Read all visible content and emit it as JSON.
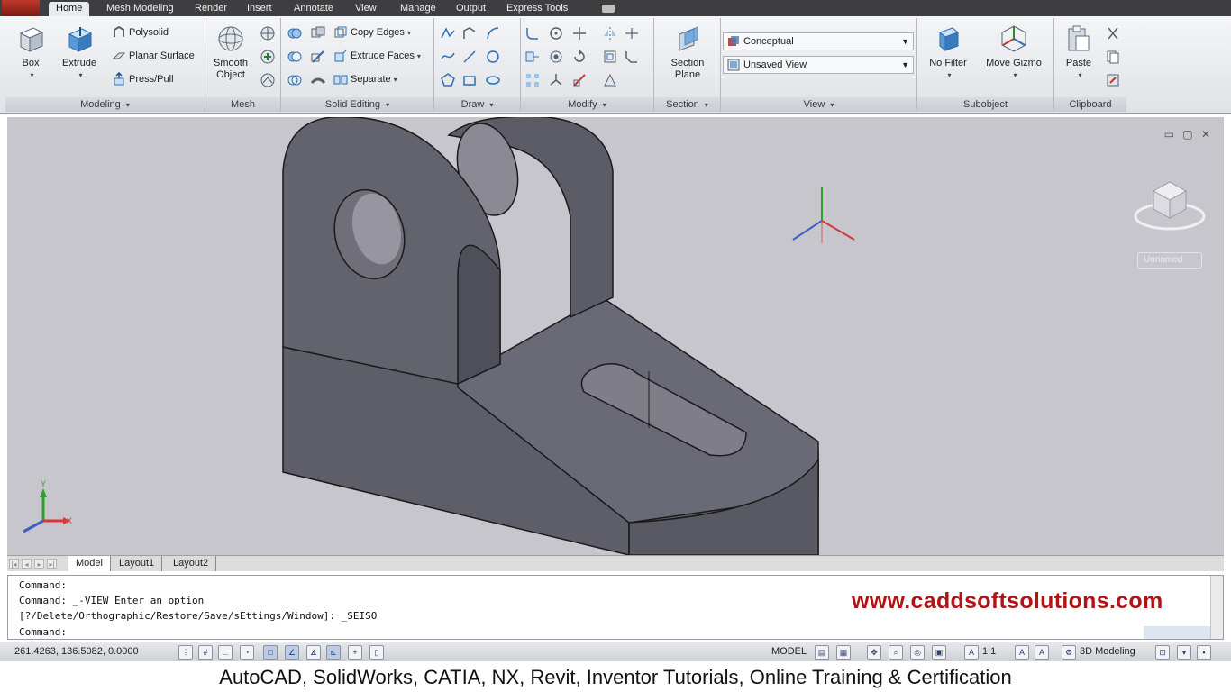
{
  "ribbon_tabs": [
    "Home",
    "Mesh Modeling",
    "Render",
    "Insert",
    "Annotate",
    "View",
    "Manage",
    "Output",
    "Express Tools"
  ],
  "active_tab": "Home",
  "panels": {
    "modeling": {
      "title": "Modeling",
      "box": "Box",
      "extrude": "Extrude",
      "polysolid": "Polysolid",
      "planar_surface": "Planar Surface",
      "press_pull": "Press/Pull"
    },
    "mesh": {
      "title": "Mesh",
      "smooth_object": "Smooth Object"
    },
    "solid_editing": {
      "title": "Solid Editing",
      "copy_edges": "Copy Edges",
      "extrude_faces": "Extrude Faces",
      "separate": "Separate"
    },
    "draw": {
      "title": "Draw"
    },
    "modify": {
      "title": "Modify"
    },
    "section": {
      "title": "Section",
      "section_plane": "Section Plane"
    },
    "view": {
      "title": "View",
      "visual_style": "Conceptual",
      "named_view": "Unsaved View"
    },
    "subobject": {
      "title": "Subobject",
      "no_filter": "No Filter",
      "move_gizmo": "Move Gizmo"
    },
    "clipboard": {
      "title": "Clipboard",
      "paste": "Paste"
    }
  },
  "viewport": {
    "controls": "▭ ▢ ✕",
    "viewcube_label": "Unnamed",
    "ucs_x": "X",
    "ucs_y": "Y",
    "model_fill": "#5f5f6a",
    "background": "#c7c6cc"
  },
  "layout_tabs": [
    "Model",
    "Layout1",
    "Layout2"
  ],
  "command": {
    "line1": "Command:",
    "line2": "Command: _-VIEW Enter an option",
    "line3": "[?/Delete/Orthographic/Restore/Save/sEttings/Window]: _SEISO",
    "prompt": "Command:",
    "watermark": "www.caddsoftsolutions.com"
  },
  "status": {
    "coords": "261.4263, 136.5082, 0.0000",
    "model": "MODEL",
    "scale": "1:1",
    "workspace": "3D Modeling"
  },
  "caption": "AutoCAD, SolidWorks, CATIA, NX, Revit, Inventor Tutorials, Online Training & Certification",
  "colors": {
    "accent": "#b01414",
    "tab_bar": "#3e3e40",
    "ribbon": "#e4e7ea"
  }
}
